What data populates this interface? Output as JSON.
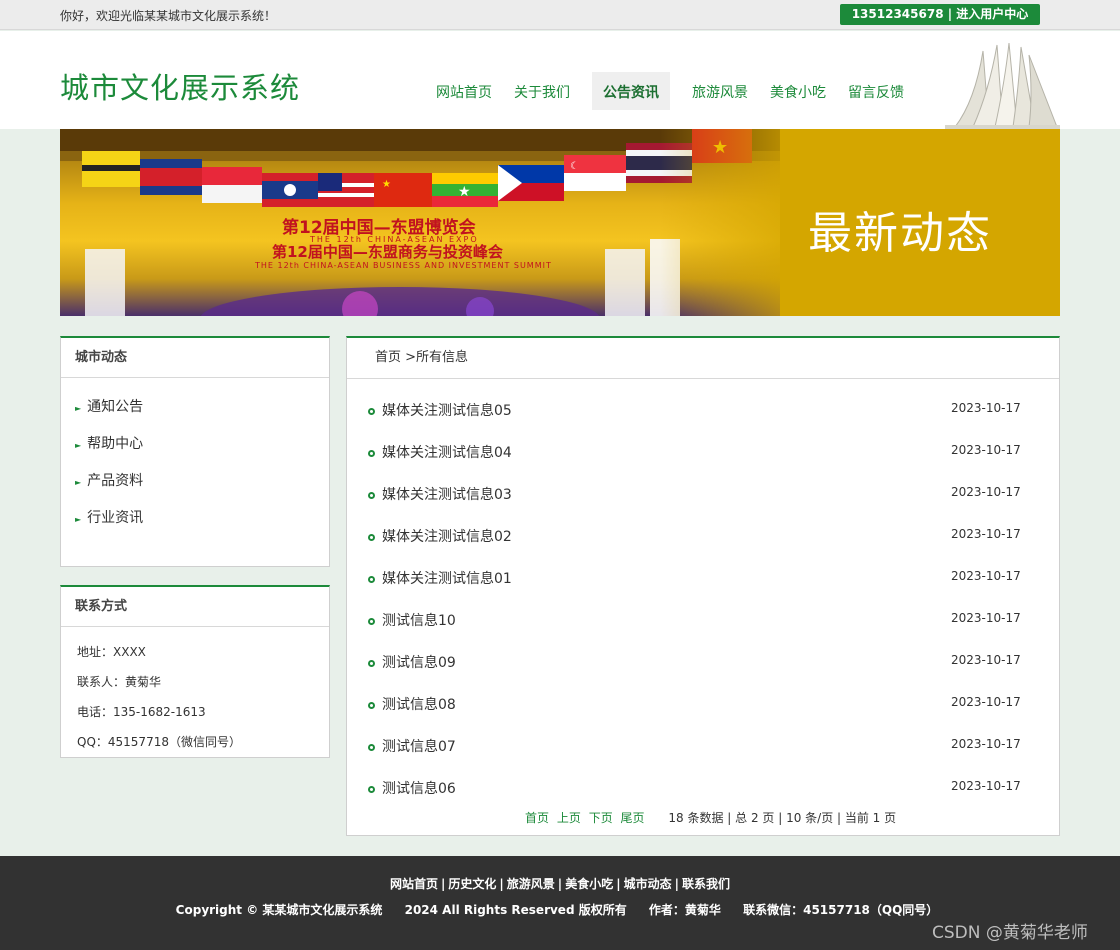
{
  "topbar": {
    "welcome": "你好，欢迎光临某某城市文化展示系统！",
    "user_button": "13512345678  | 进入用户中心"
  },
  "header": {
    "logo": "城市文化展示系统",
    "nav": [
      {
        "label": "网站首页",
        "active": false
      },
      {
        "label": "关于我们",
        "active": false
      },
      {
        "label": "公告资讯",
        "active": true
      },
      {
        "label": "旅游风景",
        "active": false
      },
      {
        "label": "美食小吃",
        "active": false
      },
      {
        "label": "留言反馈",
        "active": false
      }
    ]
  },
  "banner": {
    "title": "最新动态",
    "expo_line1": "第12届中国—东盟博览会",
    "expo_line1_en": "THE 12th CHINA-ASEAN EXPO",
    "expo_line2": "第12届中国—东盟商务与投资峰会",
    "expo_line2_en": "THE 12th CHINA-ASEAN BUSINESS AND INVESTMENT SUMMIT"
  },
  "sidebar": {
    "dynamics_title": "城市动态",
    "items": [
      "通知公告",
      "帮助中心",
      "产品资料",
      "行业资讯"
    ],
    "contact_title": "联系方式",
    "contact": [
      "地址：XXXX",
      "联系人：黄菊华",
      "电话：135-1682-1613",
      "QQ：45157718（微信同号）"
    ]
  },
  "main": {
    "breadcrumb": "首页 >所有信息",
    "news": [
      {
        "title": "媒体关注测试信息05",
        "date": "2023-10-17"
      },
      {
        "title": "媒体关注测试信息04",
        "date": "2023-10-17"
      },
      {
        "title": "媒体关注测试信息03",
        "date": "2023-10-17"
      },
      {
        "title": "媒体关注测试信息02",
        "date": "2023-10-17"
      },
      {
        "title": "媒体关注测试信息01",
        "date": "2023-10-17"
      },
      {
        "title": "测试信息10",
        "date": "2023-10-17"
      },
      {
        "title": "测试信息09",
        "date": "2023-10-17"
      },
      {
        "title": "测试信息08",
        "date": "2023-10-17"
      },
      {
        "title": "测试信息07",
        "date": "2023-10-17"
      },
      {
        "title": "测试信息06",
        "date": "2023-10-17"
      }
    ],
    "pager": {
      "first": "首页",
      "prev": "上页",
      "next": "下页",
      "last": "尾页",
      "info": "18 条数据 | 总 2 页 | 10 条/页 | 当前 1 页"
    }
  },
  "footer": {
    "links": [
      "网站首页",
      "历史文化",
      "旅游风景",
      "美食小吃",
      "城市动态",
      "联系我们"
    ],
    "copyright": "Copyright © 某某城市文化展示系统",
    "rights": "2024 All Rights Reserved 版权所有",
    "author": "作者：黄菊华",
    "wechat": "联系微信：45157718（QQ同号）",
    "watermark": "CSDN @黄菊华老师"
  },
  "colors": {
    "brand_green": "#1c8a3a",
    "footer_bg": "#323232",
    "banner_gold": "#d4a600"
  }
}
